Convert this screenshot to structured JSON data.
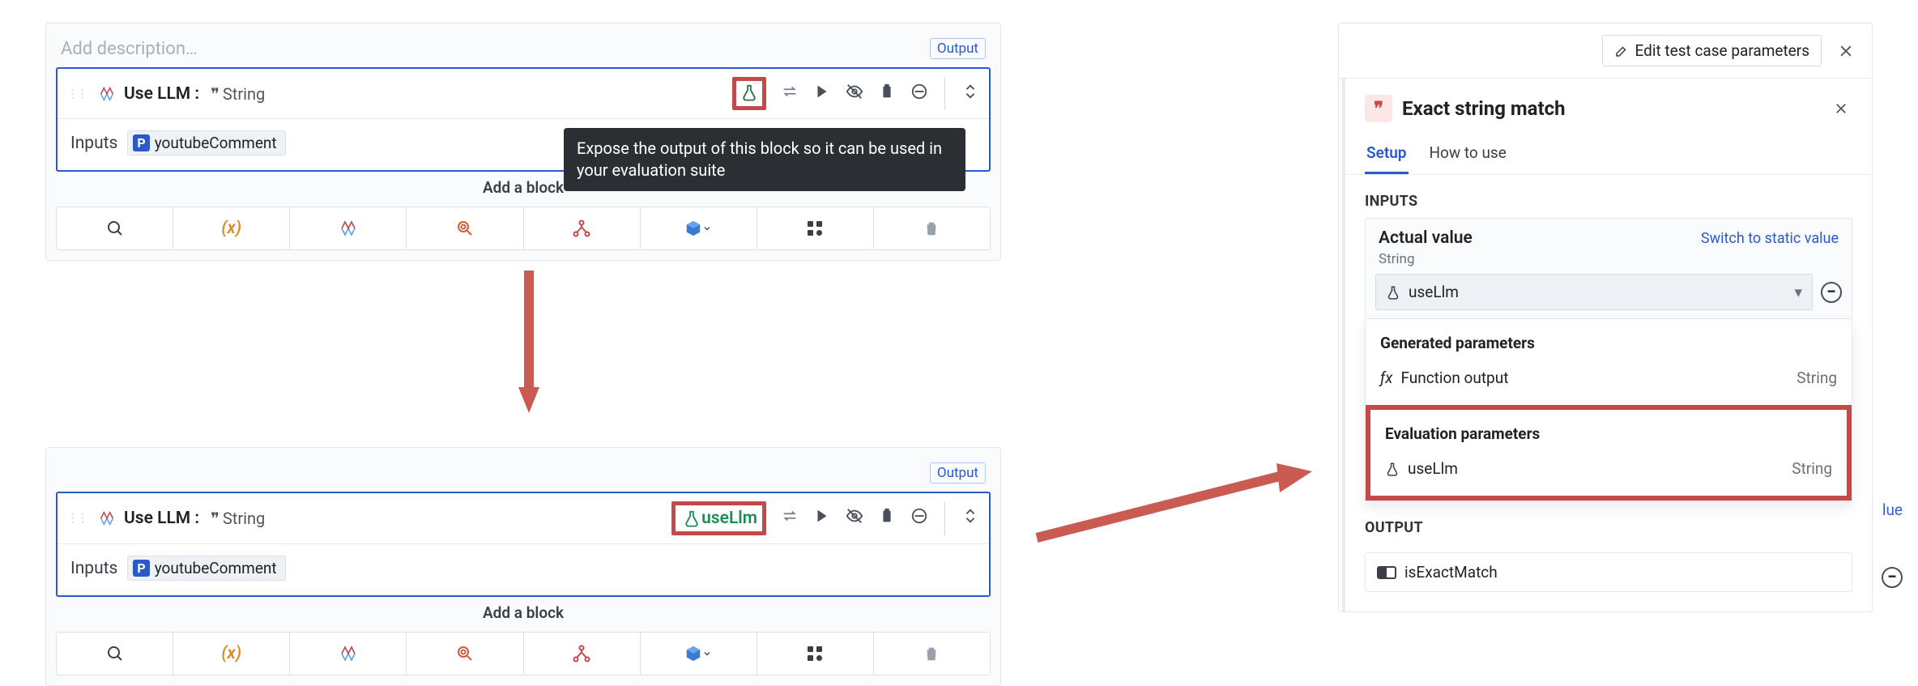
{
  "panel1": {
    "description_placeholder": "Add description…",
    "output_label": "Output",
    "block": {
      "title": "Use LLM :",
      "type": "String",
      "lab_label": "",
      "input_label": "Inputs",
      "input_param": "youtubeComment",
      "add_block": "Add a block"
    },
    "tooltip": "Expose the output of this block so it can be used in your evaluation suite"
  },
  "panel2": {
    "description_placeholder": "",
    "output_label": "Output",
    "block": {
      "title": "Use LLM :",
      "type": "String",
      "lab_label": "useLlm",
      "input_label": "Inputs",
      "input_param": "youtubeComment",
      "add_block": "Add a block"
    }
  },
  "config": {
    "edit_button": "Edit test case parameters",
    "title": "Exact string match",
    "tabs": {
      "setup": "Setup",
      "howto": "How to use"
    },
    "inputs_label": "INPUTS",
    "actual": {
      "label": "Actual value",
      "switch": "Switch to static value",
      "type": "String",
      "selected": "useLlm"
    },
    "dropdown": {
      "group1_head": "Generated parameters",
      "group1_item": "Function output",
      "group1_type": "String",
      "group2_head": "Evaluation parameters",
      "group2_item": "useLlm",
      "group2_type": "String"
    },
    "expected_lue": "lue",
    "output_label": "OUTPUT",
    "output_value": "isExactMatch"
  }
}
